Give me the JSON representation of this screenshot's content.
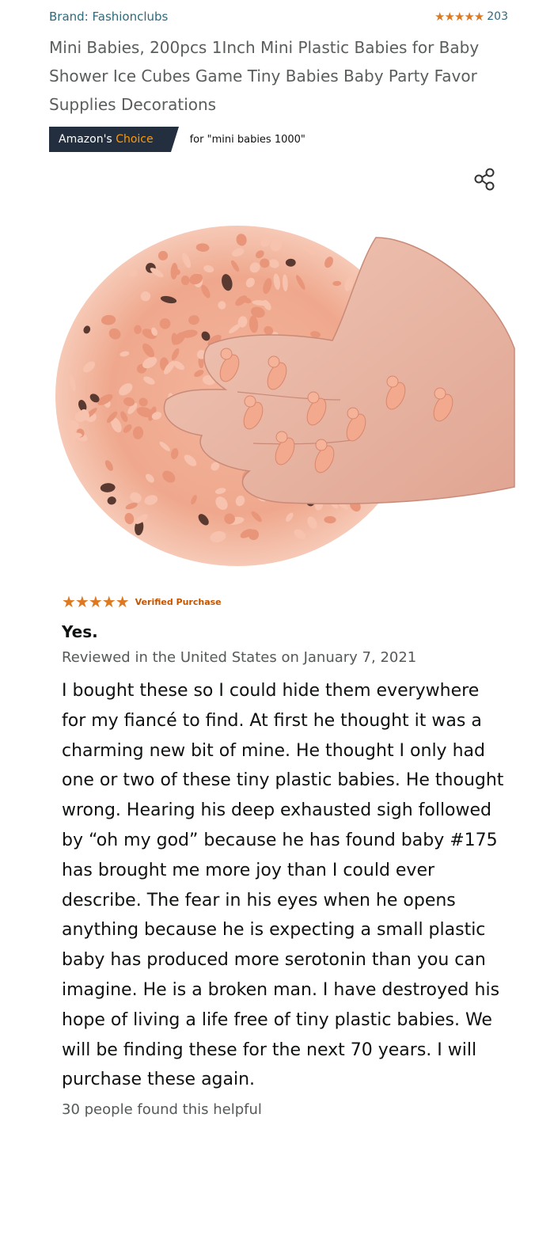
{
  "product": {
    "brand": "Brand: Fashionclubs",
    "stars": "★★★★★",
    "rating_count": "203",
    "title": "Mini Babies, 200pcs 1Inch Mini Plastic Babies for Baby Shower Ice Cubes Game Tiny Babies Baby Party Favor Supplies Decorations",
    "badge_text": "Amazon's",
    "badge_accent": "Choice",
    "badge_query": "for \"mini babies 1000\""
  },
  "icons": {
    "share": "share-icon"
  },
  "image": {
    "alt": "pile of tiny plastic babies with a hand holding several"
  },
  "review": {
    "stars": "★★★★★",
    "verified": "Verified Purchase",
    "title": "Yes.",
    "date": "Reviewed in the United States on January 7, 2021",
    "body": "I bought these so I could hide them everywhere for my fiancé to find. At first he thought it was a charming new bit of mine. He thought I only had one or two of these tiny plastic babies. He thought wrong. Hearing his deep exhausted sigh followed by “oh my god” because he has found baby #175 has brought me more joy than I could ever describe. The fear in his eyes when he opens anything because he is expecting a small plastic baby has produced more serotonin than you can imagine. He is a broken man. I have destroyed his hope of living a life free of tiny plastic babies. We will be finding these for the next 70 years. I will purchase these again.",
    "helpful": "30 people found this helpful"
  },
  "colors": {
    "star": "#de7921",
    "link": "#2f6a7a",
    "badge_bg": "#232f3e",
    "badge_accent": "#ff9900",
    "verified": "#c45500"
  }
}
